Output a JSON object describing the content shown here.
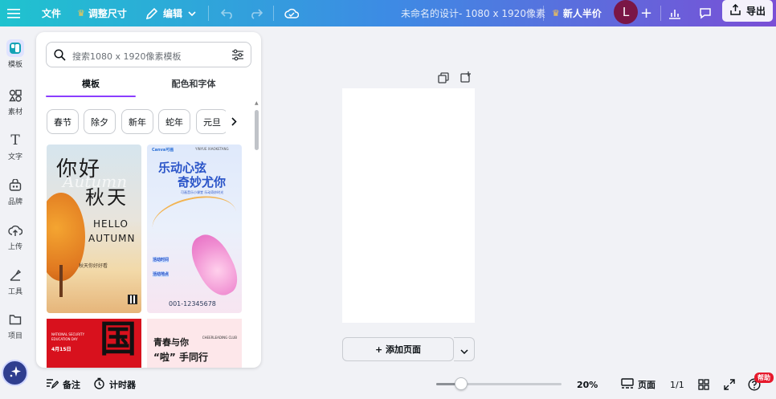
{
  "topbar": {
    "file_label": "文件",
    "resize_label": "调整尺寸",
    "edit_label": "编辑",
    "doc_title": "未命名的设计- 1080 x 1920像素",
    "promo_label": "新人半价",
    "avatar_initial": "L",
    "export_label": "导出"
  },
  "sidebar": {
    "items": [
      {
        "label": "模板",
        "icon": "template-icon"
      },
      {
        "label": "素材",
        "icon": "elements-icon"
      },
      {
        "label": "文字",
        "icon": "text-icon"
      },
      {
        "label": "品牌",
        "icon": "brand-icon"
      },
      {
        "label": "上传",
        "icon": "upload-icon"
      },
      {
        "label": "工具",
        "icon": "tools-icon"
      },
      {
        "label": "项目",
        "icon": "folder-icon"
      }
    ]
  },
  "panel": {
    "search_placeholder": "搜索1080 x 1920像素模板",
    "tabs": [
      "模板",
      "配色和字体"
    ],
    "chips": [
      "春节",
      "除夕",
      "新年",
      "蛇年",
      "元旦"
    ],
    "templates": [
      {
        "title_line1": "你好",
        "title_line2": "秋天",
        "script": "Autumn",
        "hello": "HELLO",
        "autumn": "AUTUMN",
        "sub": "秋天你好好看"
      },
      {
        "brand": "Canva可画",
        "header_right": "YINYUE XIAOKETANG",
        "title_line1": "乐动心弦",
        "title_line2": "奇妙尤你",
        "tagline": "可画音乐小课堂 乐动奇妙时光",
        "section1": "活动时间",
        "section2": "活动地点",
        "phone": "001-12345678"
      },
      {
        "line1": "NATIONAL SECURITY",
        "line2": "EDUCATION DAY",
        "date": "4月15日",
        "big": "国"
      },
      {
        "title_line1": "青春与你",
        "tag": "CHEERLEADING CLUB",
        "title_line2": "“啦” 手同行"
      }
    ]
  },
  "canvas": {
    "add_page_label": "+ 添加页面"
  },
  "bottombar": {
    "notes_label": "备注",
    "timer_label": "计时器",
    "zoom_value": "20%",
    "zoom_level": 0.2,
    "pages_label": "页面",
    "page_count": "1/1",
    "help_badge": "帮助"
  },
  "colors": {
    "accent": "#8b3dff",
    "topbar_start": "#1fc3cf",
    "topbar_end": "#7a4fd6",
    "avatar_bg": "#7a1646"
  }
}
